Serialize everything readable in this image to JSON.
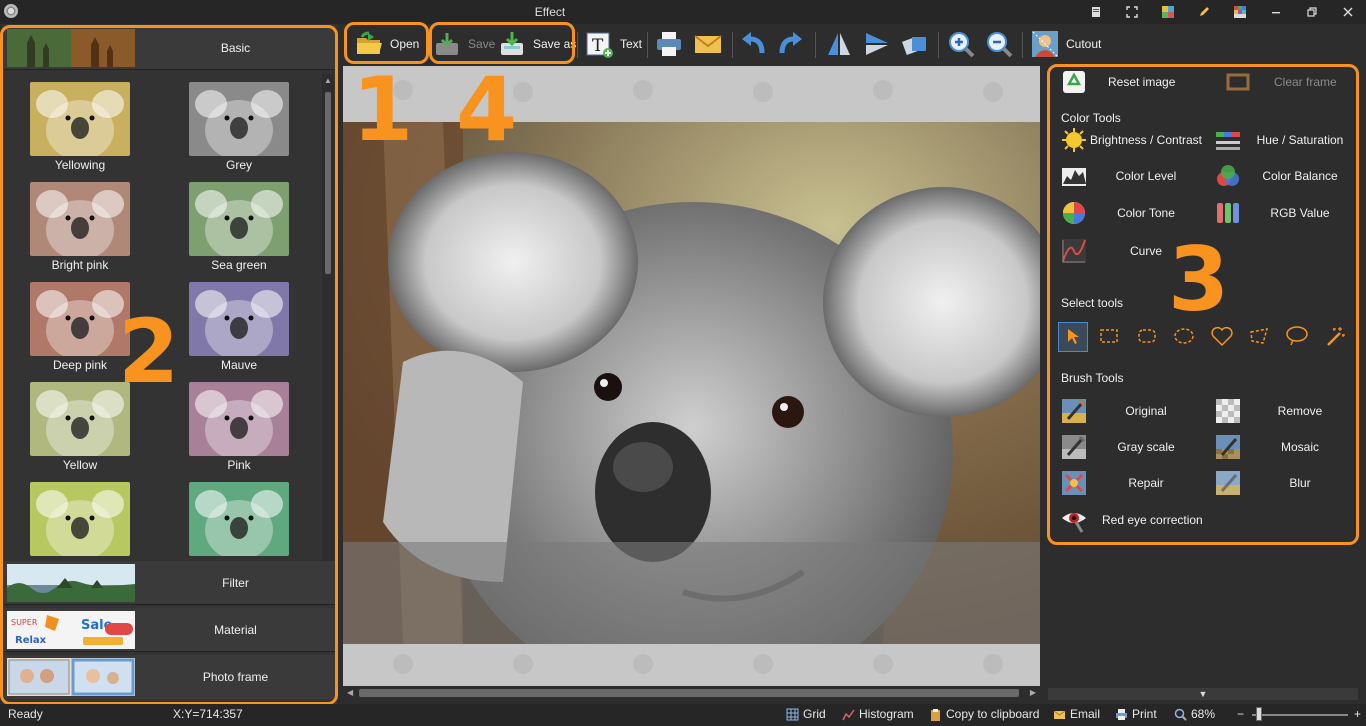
{
  "window": {
    "title": "Effect"
  },
  "toolbar": {
    "open": "Open",
    "save": "Save",
    "save_as": "Save as",
    "text": "Text",
    "cutout": "Cutout"
  },
  "left_panel": {
    "categories": {
      "basic": "Basic",
      "filter": "Filter",
      "material": "Material",
      "photo_frame": "Photo frame"
    },
    "effects": [
      {
        "label": "Yellowing",
        "tint": "#c8b060"
      },
      {
        "label": "Grey",
        "tint": "#8a8a8a"
      },
      {
        "label": "Bright pink",
        "tint": "#b08878"
      },
      {
        "label": "Sea green",
        "tint": "#7ea070"
      },
      {
        "label": "Deep pink",
        "tint": "#b07868"
      },
      {
        "label": "Mauve",
        "tint": "#8078a8"
      },
      {
        "label": "Yellow",
        "tint": "#b0b880"
      },
      {
        "label": "Pink",
        "tint": "#a88098"
      },
      {
        "label": "",
        "tint": "#b8c860"
      },
      {
        "label": "",
        "tint": "#60a880"
      }
    ]
  },
  "right_panel": {
    "reset_image": "Reset image",
    "clear_frame": "Clear frame",
    "color_tools_title": "Color Tools",
    "color_tools": [
      "Brightness / Contrast",
      "Hue / Saturation",
      "Color Level",
      "Color Balance",
      "Color Tone",
      "RGB Value",
      "Curve"
    ],
    "select_tools_title": "Select tools",
    "brush_tools_title": "Brush Tools",
    "brush_tools": [
      "Original",
      "Remove",
      "Gray scale",
      "Mosaic",
      "Repair",
      "Blur"
    ],
    "red_eye": "Red eye correction"
  },
  "annotations": [
    "1",
    "2",
    "3",
    "4"
  ],
  "status": {
    "ready": "Ready",
    "coords": "X:Y=714:357",
    "grid": "Grid",
    "histogram": "Histogram",
    "copy": "Copy to clipboard",
    "email": "Email",
    "print": "Print",
    "zoom": "68%",
    "minus": "−",
    "plus": "+"
  },
  "colors": {
    "accent": "#f7931e",
    "panel": "#2d2d2d"
  }
}
